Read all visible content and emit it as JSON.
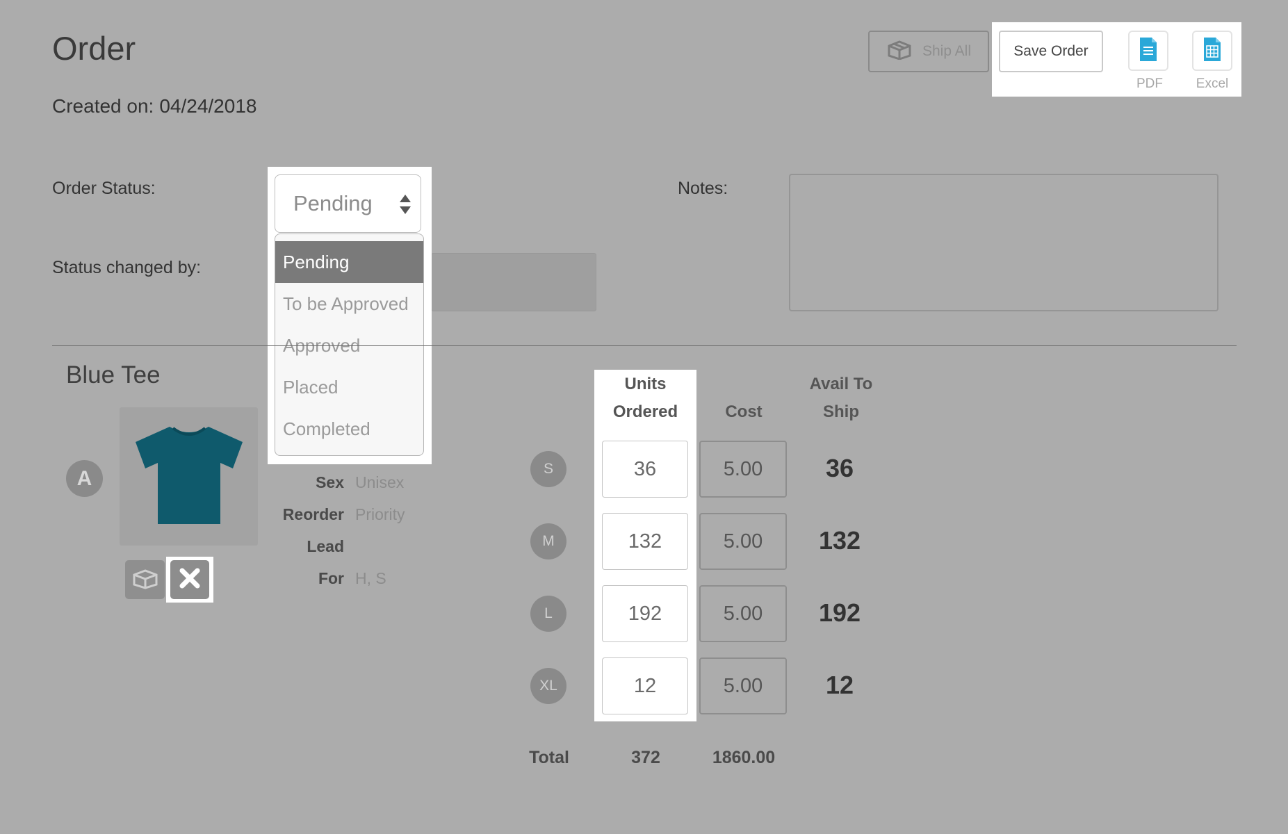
{
  "header": {
    "title": "Order",
    "created_label": "Created on:",
    "created_date": "04/24/2018"
  },
  "toolbar": {
    "ship_all_label": "Ship All",
    "save_label": "Save Order",
    "pdf_label": "PDF",
    "excel_label": "Excel"
  },
  "form": {
    "order_status_label": "Order Status:",
    "status_changed_label": "Status changed by:",
    "notes_label": "Notes:",
    "status_value": "Pending",
    "status_options": [
      "Pending",
      "To be Approved",
      "Approved",
      "Placed",
      "Completed"
    ],
    "selected_option": "Pending"
  },
  "product": {
    "name": "Blue Tee",
    "badge": "A",
    "image_icon": "tshirt-icon",
    "tshirt_color": "#0f5a6c",
    "attributes": [
      {
        "key": "Sex",
        "value": "Unisex"
      },
      {
        "key": "Reorder",
        "value": "Priority"
      },
      {
        "key": "Lead",
        "value": ""
      },
      {
        "key": "For",
        "value": "H, S"
      }
    ]
  },
  "sizes_table": {
    "headers": {
      "units_line1": "Units",
      "units_line2": "Ordered",
      "cost": "Cost",
      "avail_line1": "Avail To",
      "avail_line2": "Ship"
    },
    "rows": [
      {
        "size": "S",
        "units": "36",
        "cost": "5.00",
        "avail": "36"
      },
      {
        "size": "M",
        "units": "132",
        "cost": "5.00",
        "avail": "132"
      },
      {
        "size": "L",
        "units": "192",
        "cost": "5.00",
        "avail": "192"
      },
      {
        "size": "XL",
        "units": "12",
        "cost": "5.00",
        "avail": "12"
      }
    ],
    "total_label": "Total",
    "total_units": "372",
    "total_cost": "1860.00"
  },
  "colors": {
    "background": "#acacac",
    "highlight": "#ffffff",
    "selected_option": "#7a7a7a",
    "doc_icon": "#2aa8d8"
  }
}
